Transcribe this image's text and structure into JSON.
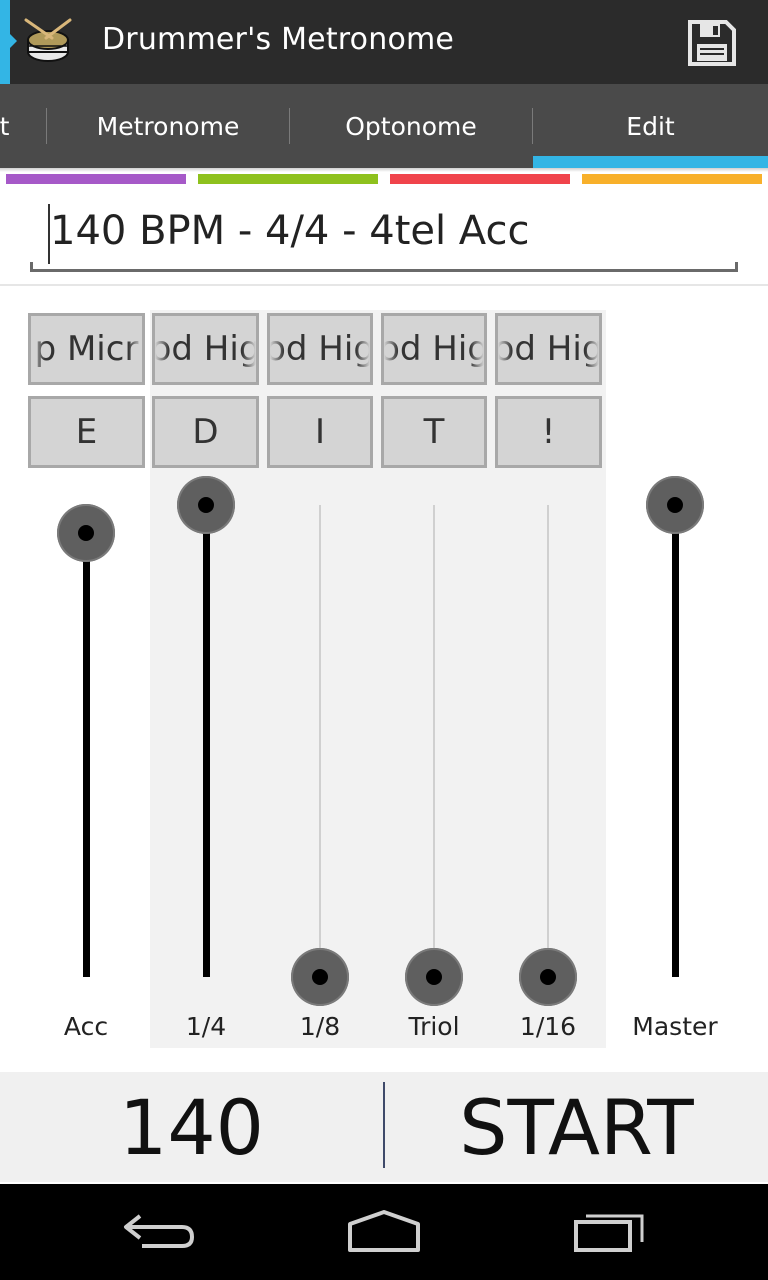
{
  "app": {
    "title": "Drummer's Metronome"
  },
  "tabs": [
    {
      "label": "st"
    },
    {
      "label": "Metronome"
    },
    {
      "label": "Optonome"
    },
    {
      "label": "Edit",
      "selected": true
    }
  ],
  "colors": {
    "accent": "#33b5e5",
    "strip": [
      "#a659c8",
      "#8ec11d",
      "#f0434b",
      "#f8b02a"
    ]
  },
  "preset": {
    "name": "140 BPM - 4/4 - 4tel Acc"
  },
  "channels": [
    {
      "sound": "p Micr",
      "key": "E",
      "label": "Acc",
      "level": 0.94
    },
    {
      "sound": "od Hig",
      "key": "D",
      "label": "1/4",
      "level": 1.0
    },
    {
      "sound": "od Hig",
      "key": "I",
      "label": "1/8",
      "level": 0.0
    },
    {
      "sound": "od Hig",
      "key": "T",
      "label": "Triol",
      "level": 0.0
    },
    {
      "sound": "od Hig",
      "key": "!",
      "label": "1/16",
      "level": 0.0
    }
  ],
  "master": {
    "label": "Master",
    "level": 1.0
  },
  "controls": {
    "bpm": "140",
    "start_label": "START"
  },
  "icons": {
    "app": "snare-drum-icon",
    "save": "floppy-disk-icon",
    "back": "back-icon",
    "home": "home-icon",
    "recents": "recent-apps-icon"
  }
}
